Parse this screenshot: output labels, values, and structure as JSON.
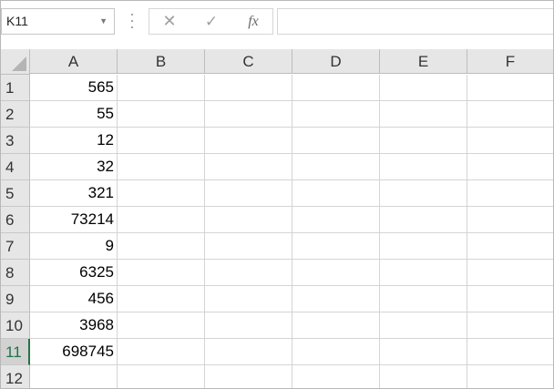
{
  "name_box": {
    "value": "K11",
    "dropdown_icon": "chevron-down-icon"
  },
  "formula_bar": {
    "cancel_icon": "✕",
    "enter_icon": "✓",
    "fx_label": "fx",
    "formula_value": ""
  },
  "columns": [
    "A",
    "B",
    "C",
    "D",
    "E",
    "F"
  ],
  "rows": [
    {
      "num": "1",
      "a": "565"
    },
    {
      "num": "2",
      "a": "55"
    },
    {
      "num": "3",
      "a": "12"
    },
    {
      "num": "4",
      "a": "32"
    },
    {
      "num": "5",
      "a": "321"
    },
    {
      "num": "6",
      "a": "73214"
    },
    {
      "num": "7",
      "a": "9"
    },
    {
      "num": "8",
      "a": "6325"
    },
    {
      "num": "9",
      "a": "456"
    },
    {
      "num": "10",
      "a": "3968"
    },
    {
      "num": "11",
      "a": "698745"
    },
    {
      "num": "12",
      "a": ""
    }
  ],
  "active_row": "11",
  "colors": {
    "accent": "#217346",
    "header_bg": "#e6e6e6",
    "grid_line": "#d4d4d4"
  }
}
